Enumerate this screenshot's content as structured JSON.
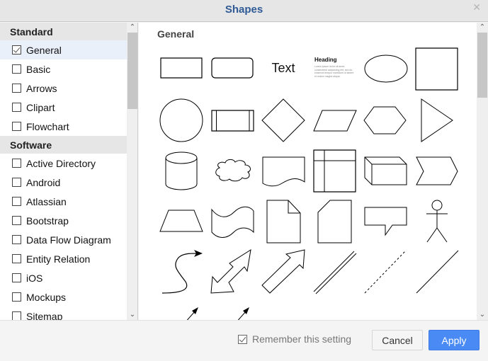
{
  "dialog": {
    "title": "Shapes",
    "close_icon": "close-icon"
  },
  "sidebar": {
    "sections": [
      {
        "title": "Standard",
        "items": [
          {
            "label": "General",
            "checked": true,
            "selected": true
          },
          {
            "label": "Basic",
            "checked": false
          },
          {
            "label": "Arrows",
            "checked": false
          },
          {
            "label": "Clipart",
            "checked": false
          },
          {
            "label": "Flowchart",
            "checked": false
          }
        ]
      },
      {
        "title": "Software",
        "items": [
          {
            "label": "Active Directory",
            "checked": false
          },
          {
            "label": "Android",
            "checked": false
          },
          {
            "label": "Atlassian",
            "checked": false
          },
          {
            "label": "Bootstrap",
            "checked": false
          },
          {
            "label": "Data Flow Diagram",
            "checked": false
          },
          {
            "label": "Entity Relation",
            "checked": false
          },
          {
            "label": "iOS",
            "checked": false
          },
          {
            "label": "Mockups",
            "checked": false
          },
          {
            "label": "Sitemap",
            "checked": false
          }
        ]
      }
    ]
  },
  "main": {
    "title": "General",
    "text_shape_label": "Text",
    "heading_shape": {
      "heading": "Heading",
      "body": "Lorem ipsum dolor sit amet, consectetur adipisicing elit, sed do eiusmod tempor incididunt ut labore et dolore magna aliqua."
    },
    "shapes": [
      "rectangle",
      "rounded-rectangle",
      "text",
      "heading-text",
      "ellipse",
      "square",
      "circle",
      "process",
      "diamond",
      "parallelogram",
      "hexagon",
      "triangle",
      "cylinder",
      "cloud",
      "document",
      "internal-storage",
      "cube",
      "step",
      "trapezoid",
      "tape",
      "note",
      "card",
      "callout",
      "actor",
      "curved-arrow",
      "bidirectional-arrow",
      "single-arrow",
      "link",
      "dashed-line",
      "line",
      "directional-connector",
      "connector-with-label"
    ]
  },
  "footer": {
    "remember_label": "Remember this setting",
    "remember_checked": true,
    "cancel_label": "Cancel",
    "apply_label": "Apply"
  },
  "colors": {
    "title": "#2f5a96",
    "apply_button": "#4a8af4",
    "selected_row": "#e9f0fa",
    "section_header": "#e6e6e6"
  }
}
